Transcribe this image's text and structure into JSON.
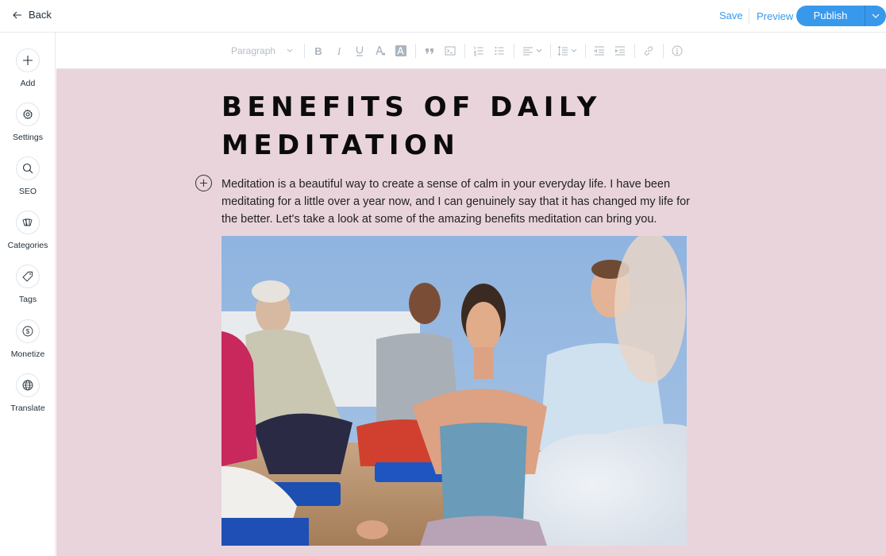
{
  "topbar": {
    "back_label": "Back",
    "save_label": "Save",
    "preview_label": "Preview",
    "publish_label": "Publish"
  },
  "colors": {
    "accent": "#3899ec",
    "canvas_bg": "#e9d4dc",
    "text": "#20303c"
  },
  "sidebar": {
    "items": [
      {
        "label": "Add",
        "icon": "plus-icon"
      },
      {
        "label": "Settings",
        "icon": "gear-icon"
      },
      {
        "label": "SEO",
        "icon": "search-icon"
      },
      {
        "label": "Categories",
        "icon": "cards-icon"
      },
      {
        "label": "Tags",
        "icon": "tag-icon"
      },
      {
        "label": "Monetize",
        "icon": "dollar-icon"
      },
      {
        "label": "Translate",
        "icon": "globe-icon"
      }
    ]
  },
  "toolbar": {
    "paragraph_style": "Paragraph",
    "buttons": [
      "bold",
      "italic",
      "underline",
      "text-color",
      "highlight",
      "quote",
      "code-block",
      "numbered-list",
      "bulleted-list",
      "align",
      "line-spacing",
      "decrease-indent",
      "increase-indent",
      "link",
      "info"
    ]
  },
  "post": {
    "title": "BENEFITS OF DAILY MEDITATION",
    "paragraph": "Meditation is a beautiful way to create a sense of calm in your everyday life. I have been meditating for a little over a year now, and I can genuinely say that it has changed my life for the better. Let's take a look at some of the amazing benefits meditation can bring you.",
    "image_alt": "Group meditation class with woman in blue tank top in foreground"
  }
}
